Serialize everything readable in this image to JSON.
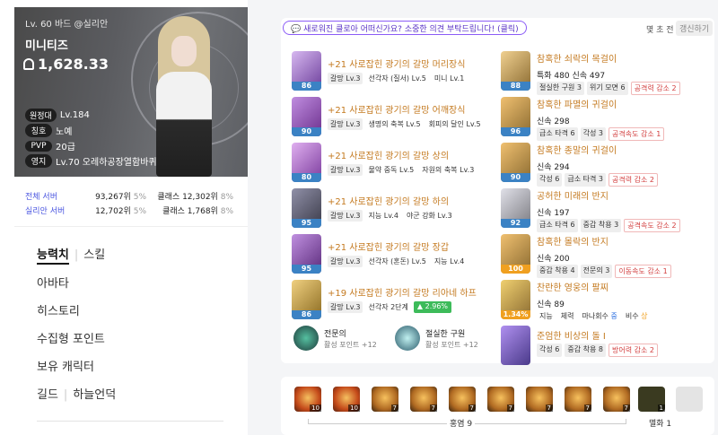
{
  "profile": {
    "class_line": "Lv. 60 바드 @실리안",
    "name": "미니티즈",
    "item_level": "1,628.33",
    "tags": [
      {
        "key": "원정대",
        "value": "Lv.184"
      },
      {
        "key": "칭호",
        "value": "노예"
      },
      {
        "key": "PVP",
        "value": "20급"
      },
      {
        "key": "영지",
        "value": "Lv.70 오레하공장열함바퀴"
      }
    ]
  },
  "ranking": [
    {
      "scope": "전체 서버",
      "rank": "93,267위",
      "pct": "5%",
      "class_label": "클래스",
      "class_rank": "12,302위",
      "class_pct": "8%"
    },
    {
      "scope": "실리안 서버",
      "rank": "12,702위",
      "pct": "5%",
      "class_label": "클래스",
      "class_rank": "1,768위",
      "class_pct": "8%"
    }
  ],
  "menu": {
    "tab_stats": "능력치",
    "tab_skill": "스킬",
    "items": [
      "아바타",
      "히스토리",
      "수집형 포인트",
      "보유 캐릭터"
    ],
    "guild": "길드",
    "guild_name": "하늘언덕"
  },
  "notice": "새로워진 클로아 어떠신가요? 소중한 의견 부탁드립니다! (클릭)",
  "updated": "몇 초 전",
  "refresh": "갱신하기",
  "equipment": [
    {
      "name": "+21 사로잡힌 광기의 갈망 머리장식",
      "level": "86",
      "color": "#3b82c4",
      "tags": [
        "갈망 Lv.3",
        "선각자 (질서) Lv.5",
        "미니 Lv.1"
      ]
    },
    {
      "name": "+21 사로잡힌 광기의 갈망 어깨장식",
      "level": "90",
      "color": "#3b82c4",
      "tags": [
        "갈망 Lv.3",
        "생명의 축복 Lv.5",
        "회피의 달인 Lv.5"
      ]
    },
    {
      "name": "+21 사로잡힌 광기의 갈망 상의",
      "level": "80",
      "color": "#3b82c4",
      "tags": [
        "갈망 Lv.3",
        "물약 중독 Lv.5",
        "자원의 축복 Lv.3"
      ]
    },
    {
      "name": "+21 사로잡힌 광기의 갈망 하의",
      "level": "95",
      "color": "#3b82c4",
      "tags": [
        "갈망 Lv.3",
        "지능 Lv.4",
        "야군 강화 Lv.3"
      ]
    },
    {
      "name": "+21 사로잡힌 광기의 갈망 장갑",
      "level": "95",
      "color": "#3b82c4",
      "tags": [
        "갈망 Lv.3",
        "선각자 (혼돈) Lv.5",
        "지능 Lv.4"
      ]
    },
    {
      "name": "+19 사로잡힌 광기의 갈망 리아네 하프",
      "level": "86",
      "color": "#3b82c4",
      "tags": [
        "갈망 Lv.3",
        "선각자 2단계"
      ],
      "bonus": "▲ 2.96%"
    }
  ],
  "accessories": [
    {
      "name": "참혹한 쇠락의 목걸이",
      "level": "88",
      "color": "#3b82c4",
      "stat": "특화 480 신속 497",
      "tags": [
        {
          "t": "절실한 구원 3",
          "k": "chip"
        },
        {
          "t": "위기 모면 6",
          "k": "chip"
        },
        {
          "t": "공격력 감소 2",
          "k": "red"
        }
      ]
    },
    {
      "name": "참혹한 파멸의 귀걸이",
      "level": "96",
      "color": "#3b82c4",
      "stat": "신속 298",
      "tags": [
        {
          "t": "급소 타격 6",
          "k": "chip"
        },
        {
          "t": "각성 3",
          "k": "chip"
        },
        {
          "t": "공격속도 감소 1",
          "k": "red"
        }
      ]
    },
    {
      "name": "참혹한 종말의 귀걸이",
      "level": "90",
      "color": "#3b82c4",
      "stat": "신속 294",
      "tags": [
        {
          "t": "각성 6",
          "k": "chip"
        },
        {
          "t": "급소 타격 3",
          "k": "chip"
        },
        {
          "t": "공격력 감소 2",
          "k": "red"
        }
      ]
    },
    {
      "name": "공허한 미래의 반지",
      "level": "92",
      "color": "#3b82c4",
      "stat": "신속 197",
      "tags": [
        {
          "t": "급소 타격 6",
          "k": "chip"
        },
        {
          "t": "중갑 착용 3",
          "k": "chip"
        },
        {
          "t": "공격속도 감소 2",
          "k": "red"
        }
      ]
    },
    {
      "name": "참혹한 몰락의 반지",
      "level": "100",
      "color": "#f0a020",
      "stat": "신속 200",
      "tags": [
        {
          "t": "중갑 착용 4",
          "k": "chip"
        },
        {
          "t": "전문의 3",
          "k": "chip"
        },
        {
          "t": "이동속도 감소 1",
          "k": "red"
        }
      ]
    },
    {
      "name": "찬란한 영웅의 팔찌",
      "level": "1.34%",
      "color": "#f0a020",
      "stat": "신속 89",
      "tags": [
        {
          "t": "지능",
          "k": "plain"
        },
        {
          "t": "체력",
          "k": "plain"
        },
        {
          "t": "마나회수 중",
          "k": "plainb"
        },
        {
          "t": "비수 상",
          "k": "plaino"
        }
      ]
    },
    {
      "name": "준엄한 비상의 돌 I",
      "level": "",
      "color": "#3b82c4",
      "stat": "",
      "tags": [
        {
          "t": "각성 6",
          "k": "chip"
        },
        {
          "t": "중갑 착용 8",
          "k": "chip"
        },
        {
          "t": "방어력 감소 2",
          "k": "red"
        }
      ]
    }
  ],
  "engravings": [
    {
      "name": "전문의",
      "points": "활성 포인트 +12"
    },
    {
      "name": "절실한 구원",
      "points": "활성 포인트 +12"
    }
  ],
  "gems": {
    "items": [
      "10",
      "10",
      "7",
      "7",
      "7",
      "7",
      "7",
      "7",
      "7",
      "1"
    ],
    "group1_label": "홍염 9",
    "group2_label": "멸화 1"
  }
}
